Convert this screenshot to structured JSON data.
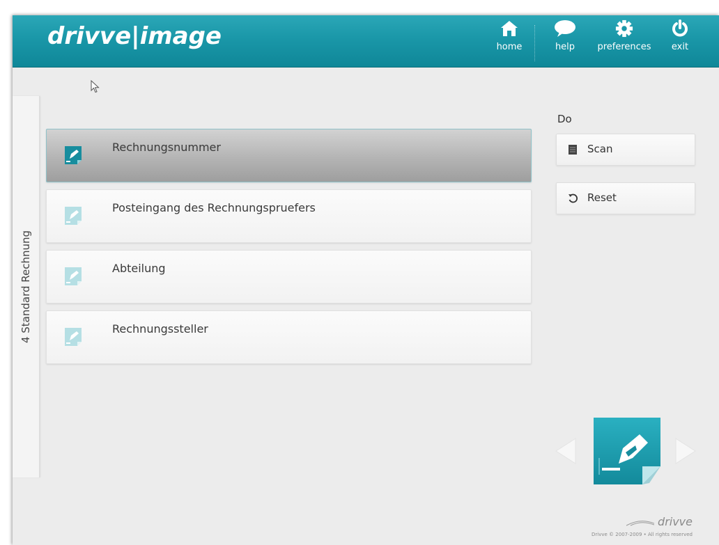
{
  "app": {
    "logo_text": "drivve|image"
  },
  "nav": {
    "home_label": "home",
    "help_label": "help",
    "preferences_label": "preferences",
    "exit_label": "exit"
  },
  "sidebar": {
    "tab_label": "4 Standard Rechnung"
  },
  "fields": {
    "items": [
      {
        "label": "Rechnungsnummer",
        "selected": true
      },
      {
        "label": "Posteingang des Rechnungspruefers",
        "selected": false
      },
      {
        "label": "Abteilung",
        "selected": false
      },
      {
        "label": "Rechnungssteller",
        "selected": false
      }
    ]
  },
  "actions": {
    "heading": "Do",
    "scan_label": "Scan",
    "reset_label": "Reset"
  },
  "footer": {
    "brand": "drivve",
    "copyright": "Drivve © 2007-2009 • All rights reserved"
  },
  "colors": {
    "header": "#1a97a8",
    "accent": "#1b9bad",
    "background": "#ececec",
    "selected_item": "#b4b4b4"
  },
  "icons": {
    "home": "home-icon",
    "help": "speech-bubble-icon",
    "preferences": "gear-icon",
    "exit": "power-icon",
    "field": "document-pen-icon",
    "scan": "scanner-icon",
    "reset": "refresh-icon",
    "prev": "arrow-left-icon",
    "next": "arrow-right-icon"
  }
}
